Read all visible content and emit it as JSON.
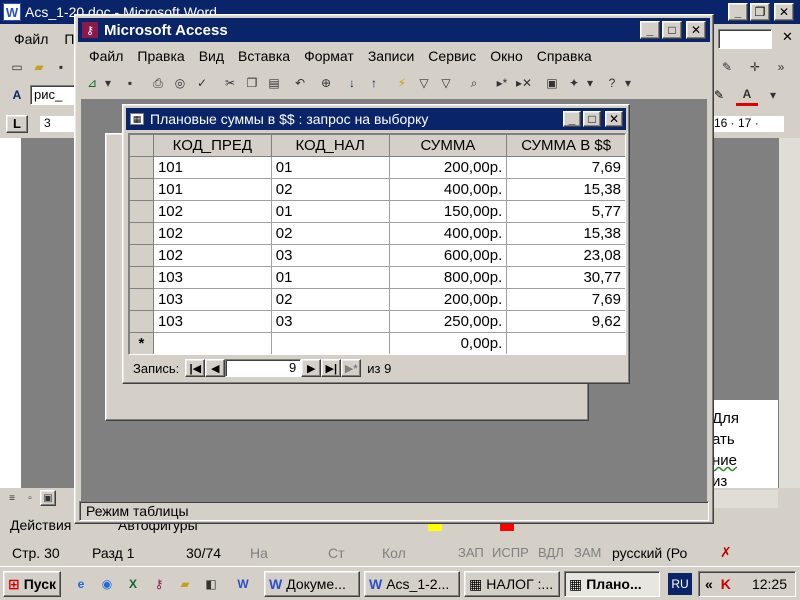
{
  "word": {
    "title": "Acs_1-20.doc - Microsoft Word",
    "menu_file": "Файл",
    "menu_second": "П",
    "style_field": "рис_",
    "tab_left": "L",
    "ruler_left": "3",
    "ruler_right": "16 · 17 ·",
    "doc_text_lines": [
      "Для",
      "ать",
      "ние",
      "из"
    ],
    "draw_actions": "Действия",
    "draw_autoshapes": "Автофигуры",
    "status": {
      "page": "Стр. 30",
      "section": "Разд 1",
      "pages": "30/74",
      "at": "На",
      "line": "Ст",
      "col": "Кол",
      "rec": "ЗАП",
      "trk": "ИСПР",
      "ext": "ВДЛ",
      "ovr": "ЗАМ",
      "lang": "русский (Ро"
    }
  },
  "access": {
    "title": "Microsoft Access",
    "menu": [
      "Файл",
      "Правка",
      "Вид",
      "Вставка",
      "Формат",
      "Записи",
      "Сервис",
      "Окно",
      "Справка"
    ],
    "status_bar": "Режим таблицы",
    "query": {
      "title": "Плановые суммы в $$ : запрос на выборку",
      "columns": [
        "КОД_ПРЕД",
        "КОД_НАЛ",
        "СУММА",
        "СУММА В $$"
      ],
      "rows": [
        [
          "101",
          "01",
          "200,00р.",
          "7,69"
        ],
        [
          "101",
          "02",
          "400,00р.",
          "15,38"
        ],
        [
          "102",
          "01",
          "150,00р.",
          "5,77"
        ],
        [
          "102",
          "02",
          "400,00р.",
          "15,38"
        ],
        [
          "102",
          "03",
          "600,00р.",
          "23,08"
        ],
        [
          "103",
          "01",
          "800,00р.",
          "30,77"
        ],
        [
          "103",
          "02",
          "200,00р.",
          "7,69"
        ],
        [
          "103",
          "03",
          "250,00р.",
          "9,62"
        ]
      ],
      "new_row": [
        "",
        "",
        "0,00р.",
        ""
      ],
      "new_row_marker": "*",
      "nav_label": "Запись:",
      "nav_current": "9",
      "nav_total": "из  9"
    }
  },
  "taskbar": {
    "start": "Пуск",
    "buttons": [
      "Докуме...",
      "Acs_1-2...",
      "НАЛОГ :...",
      "Плано..."
    ],
    "lang": "RU",
    "chevron": "«",
    "clock": "12:25"
  }
}
